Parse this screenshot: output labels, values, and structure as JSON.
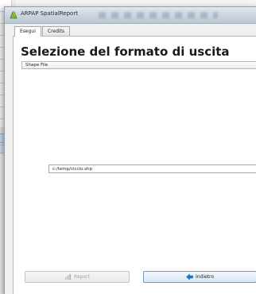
{
  "window": {
    "title": "ARPAP SpatialReport"
  },
  "tabs": [
    {
      "label": "Esegui",
      "active": true
    },
    {
      "label": "Credits",
      "active": false
    }
  ],
  "main": {
    "heading": "Selezione del formato di uscita",
    "format_value": "Shape File",
    "path_value": "c:/temp/ciccio.shp"
  },
  "buttons": {
    "report_label": "Report",
    "back_label": "Indietro"
  },
  "colors": {
    "accent": "#2d6fb8",
    "back_arrow": "#1f77c8"
  }
}
